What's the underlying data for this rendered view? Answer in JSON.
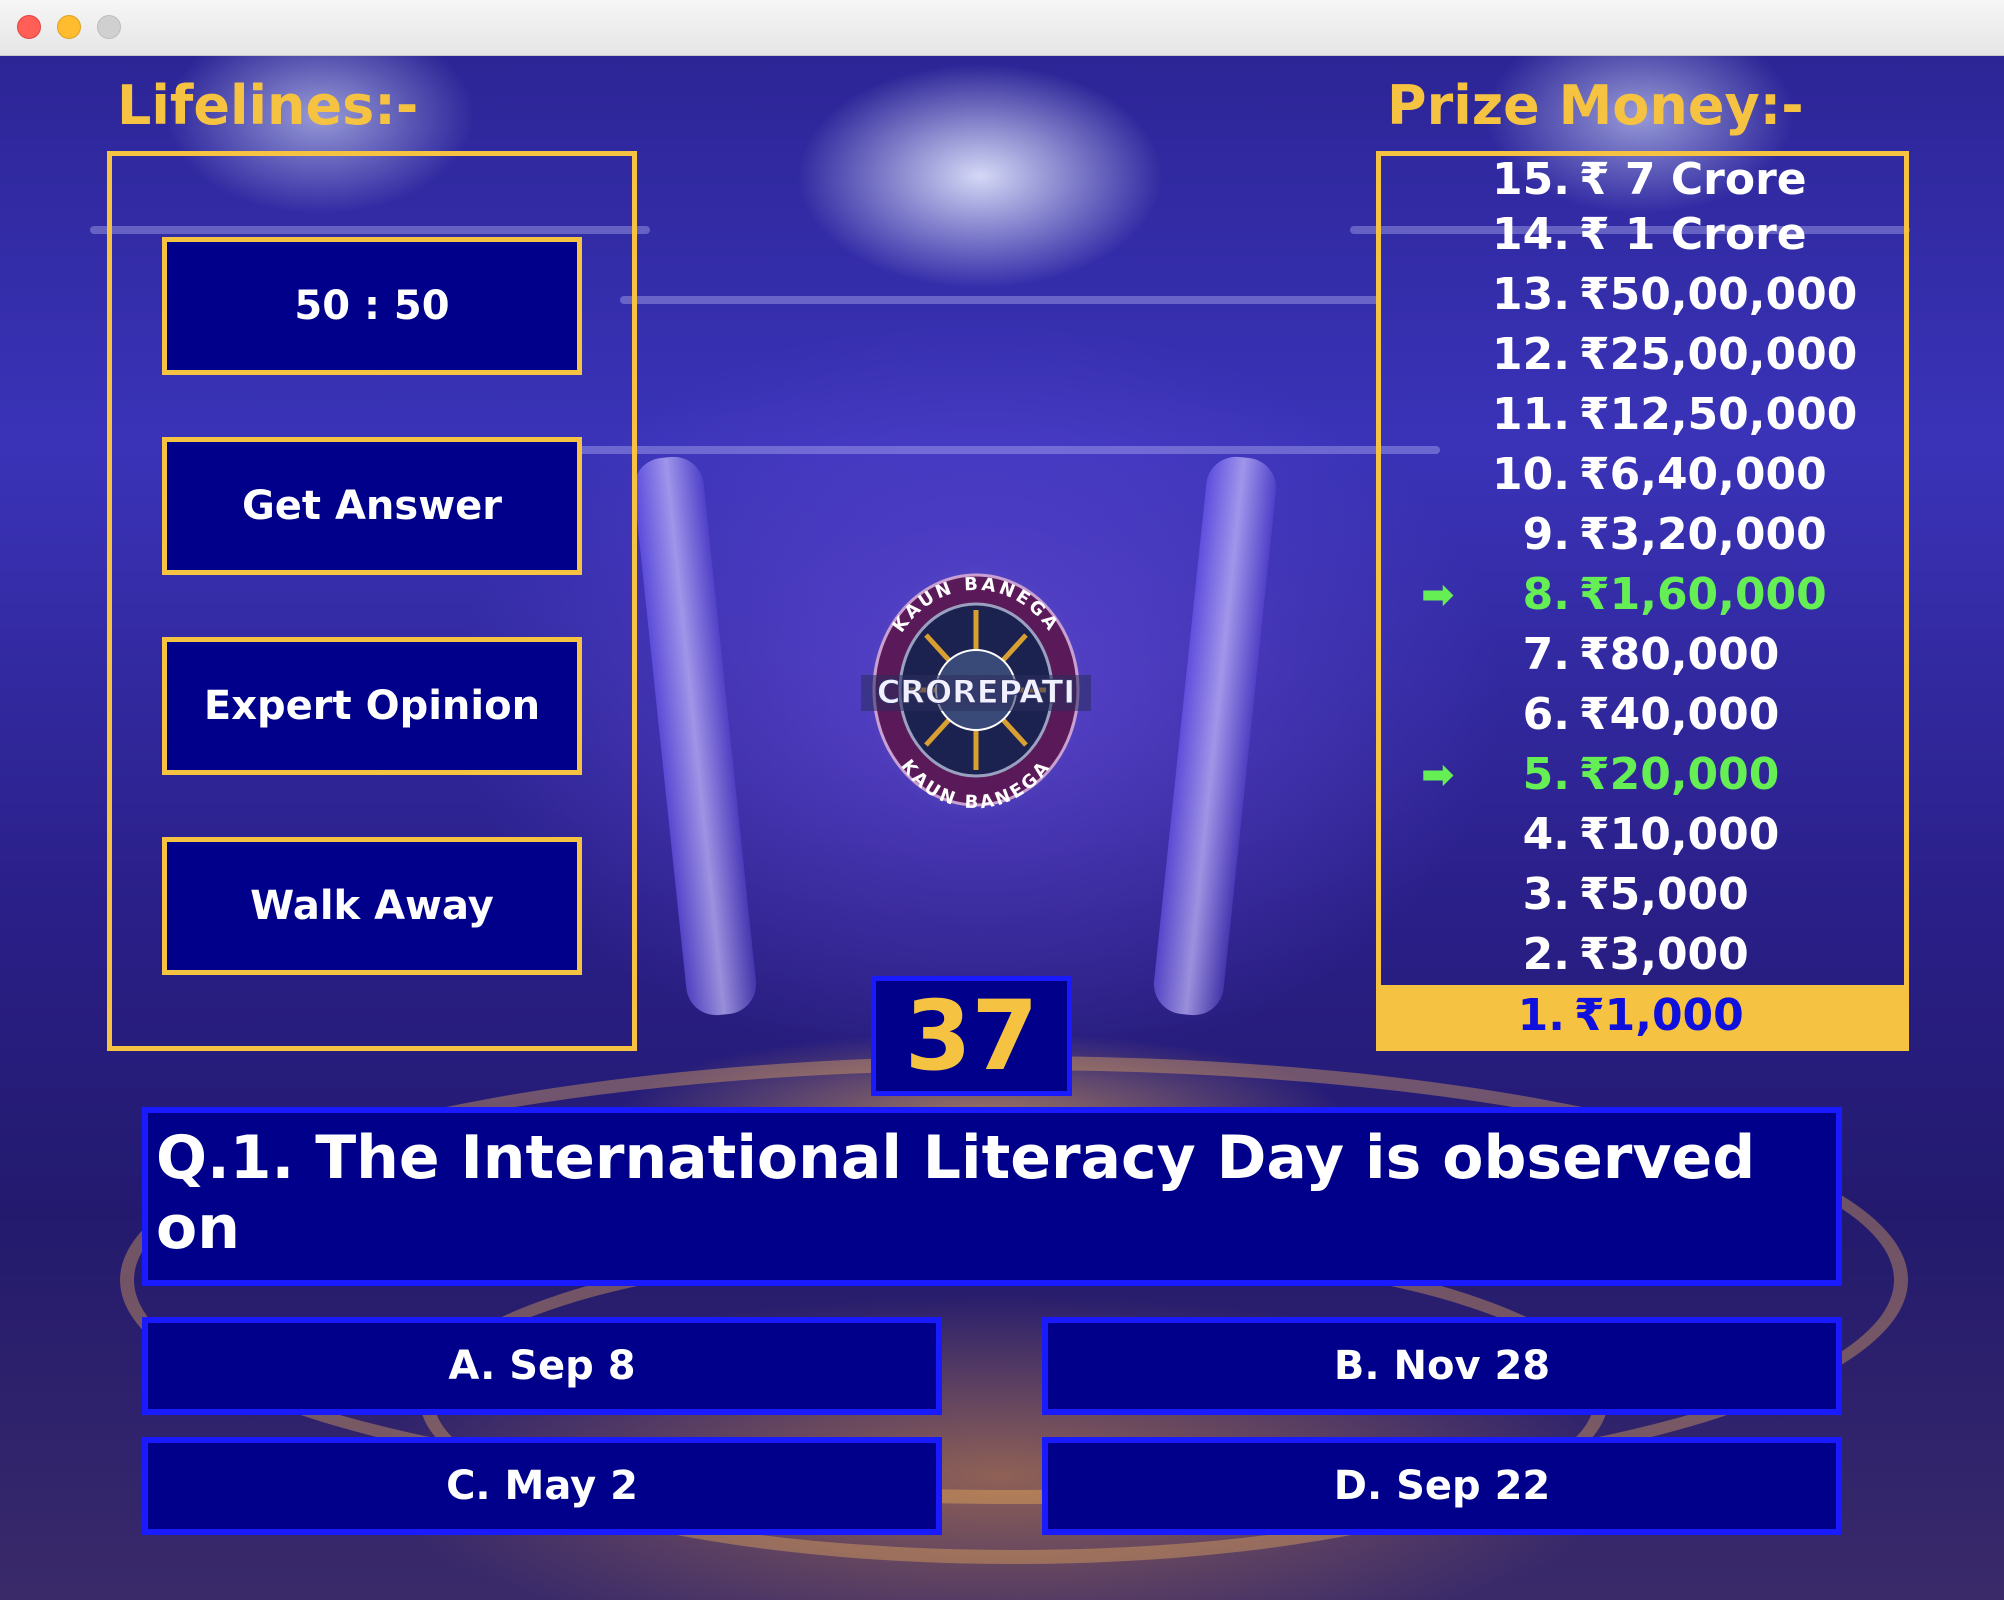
{
  "window": {
    "controls": [
      "close-button",
      "minimize-button",
      "zoom-button"
    ]
  },
  "lifelines": {
    "heading": "Lifelines:-",
    "buttons": [
      "50 : 50",
      "Get Answer",
      "Expert Opinion",
      "Walk Away"
    ]
  },
  "prize_money": {
    "heading": "Prize Money:-",
    "levels": [
      {
        "num": "15.",
        "amount": "₹ 7 Crore"
      },
      {
        "num": "14.",
        "amount": "₹ 1 Crore"
      },
      {
        "num": "13.",
        "amount": "₹50,00,000"
      },
      {
        "num": "12.",
        "amount": "₹25,00,000"
      },
      {
        "num": "11.",
        "amount": "₹12,50,000"
      },
      {
        "num": "10.",
        "amount": "₹6,40,000"
      },
      {
        "num": "9.",
        "amount": "₹3,20,000"
      },
      {
        "num": "8.",
        "amount": "₹1,60,000",
        "safe": true
      },
      {
        "num": "7.",
        "amount": "₹80,000"
      },
      {
        "num": "6.",
        "amount": "₹40,000"
      },
      {
        "num": "5.",
        "amount": "₹20,000",
        "safe": true
      },
      {
        "num": "4.",
        "amount": "₹10,000"
      },
      {
        "num": "3.",
        "amount": "₹5,000"
      },
      {
        "num": "2.",
        "amount": "₹3,000"
      },
      {
        "num": "1.",
        "amount": "₹1,000",
        "current": true
      }
    ],
    "safe_marker": "➡"
  },
  "logo": {
    "top_text": "KAUN BANEGA",
    "main_text": "CROREPATI",
    "bottom_text": "KAUN BANEGA"
  },
  "timer": "37",
  "question": "Q.1. The International Literacy Day is observed on",
  "options": {
    "a": "A. Sep 8",
    "b": "B. Nov 28",
    "c": "C. May 2",
    "d": "D. Sep 22"
  },
  "colors": {
    "accent_gold": "#f5c242",
    "panel_blue": "#00008b",
    "border_blue": "#1a1aff",
    "safe_green": "#66ee55",
    "current_text": "#1010dd"
  }
}
